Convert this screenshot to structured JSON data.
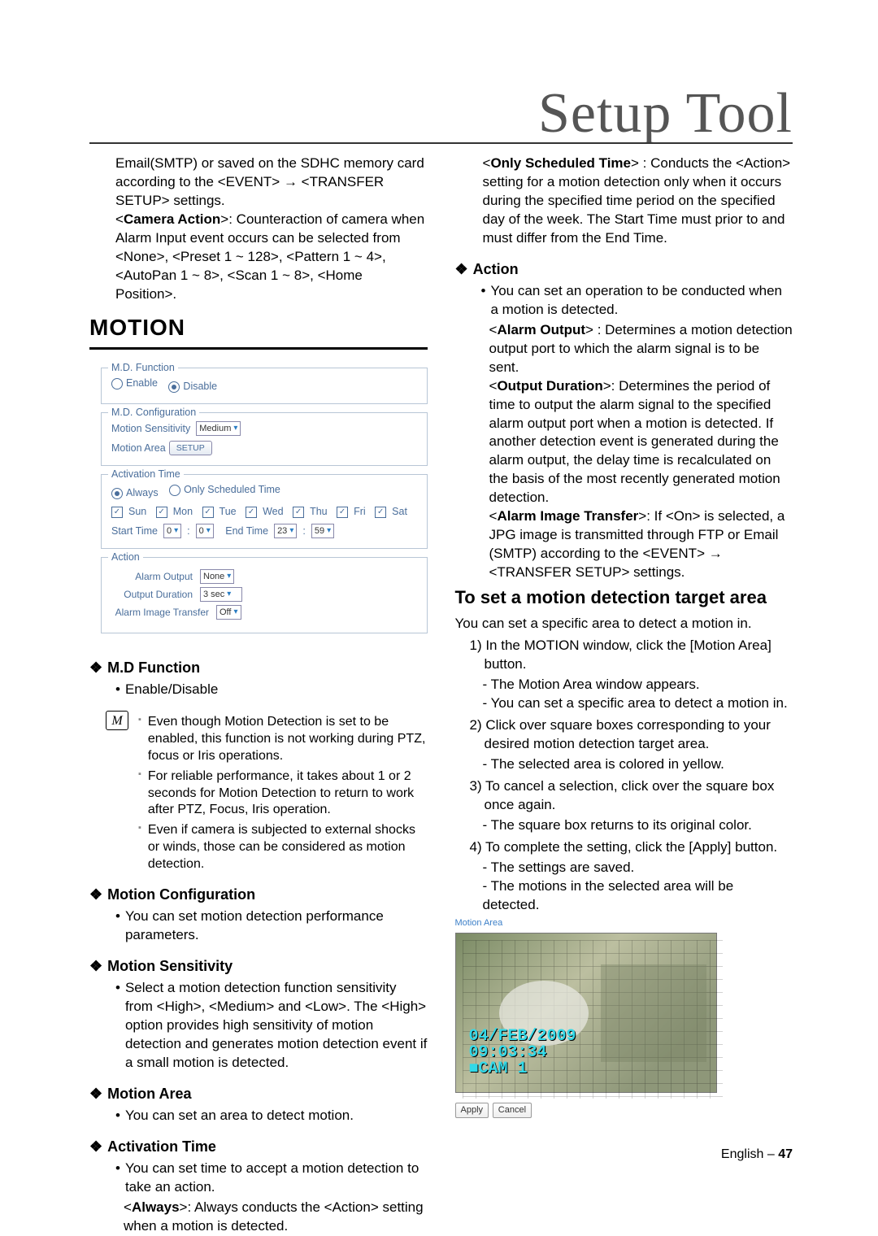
{
  "header": {
    "title": "Setup Tool"
  },
  "footer": {
    "lang": "English –",
    "page": "47"
  },
  "left": {
    "intro_para": "Email(SMTP) or saved on the SDHC memory card according to the <EVENT> → <TRANSFER SETUP> settings.",
    "camera_action_label": "Camera Action",
    "camera_action_text": ">: Counteraction of camera when Alarm Input event occurs can be selected from <None>, <Preset 1 ~ 128>, <Pattern 1 ~ 4>, <AutoPan 1 ~ 8>, <Scan 1 ~ 8>, <Home Position>.",
    "motion_heading": "MOTION",
    "fig": {
      "md_function": {
        "legend": "M.D. Function",
        "enable": "Enable",
        "disable": "Disable"
      },
      "md_config": {
        "legend": "M.D. Configuration",
        "sens_label": "Motion Sensitivity",
        "sens_value": "Medium",
        "area_label": "Motion Area",
        "setup_btn": "SETUP"
      },
      "act_time": {
        "legend": "Activation Time",
        "always": "Always",
        "scheduled": "Only Scheduled Time",
        "days": [
          "Sun",
          "Mon",
          "Tue",
          "Wed",
          "Thu",
          "Fri",
          "Sat"
        ],
        "start_label": "Start Time",
        "end_label": "End Time",
        "start_h": "0",
        "start_m": "0",
        "end_h": "23",
        "end_m": "59"
      },
      "action": {
        "legend": "Action",
        "alarm_out_label": "Alarm Output",
        "alarm_out_value": "None",
        "out_dur_label": "Output Duration",
        "out_dur_value": "3 sec",
        "img_xfer_label": "Alarm Image Transfer",
        "img_xfer_value": "Off"
      }
    },
    "s_md_function": {
      "title": "M.D Function",
      "bullet": "Enable/Disable"
    },
    "notes": {
      "n1": "Even though Motion Detection is set to be enabled, this function is not working during PTZ, focus or Iris operations.",
      "n2": "For reliable performance, it takes about 1 or 2 seconds for Motion Detection to return to work after PTZ, Focus, Iris operation.",
      "n3": "Even if camera is subjected to external shocks or winds, those can be considered as motion detection."
    },
    "s_motion_config": {
      "title": "Motion Configuration",
      "bullet": "You can set motion detection performance parameters."
    },
    "s_motion_sens": {
      "title": "Motion Sensitivity",
      "bullet": "Select a motion detection function sensitivity from <High>, <Medium> and <Low>. The <High> option provides high sensitivity of motion detection and generates motion detection event if a small motion is detected."
    },
    "s_motion_area": {
      "title": "Motion Area",
      "bullet": "You can set an area to detect motion."
    },
    "s_act_time": {
      "title": "Activation Time",
      "bullet": "You can set time to accept a motion detection to take an action.",
      "always_label": "Always",
      "always_text": ">: Always conducts the <Action> setting when a motion is detected."
    }
  },
  "right": {
    "only_scheduled_label": "Only Scheduled Time",
    "only_scheduled_text": "> : Conducts the <Action> setting for a motion detection only when it occurs during the specified time period on the specified day of the week. The Start Time must prior to and must differ from the End Time.",
    "action_title": "Action",
    "action_bullet": "You can set an operation to be conducted when a motion is detected.",
    "alarm_out_label": "Alarm Output",
    "alarm_out_text": "> : Determines a motion detection output port to which the alarm signal is to be sent.",
    "out_dur_label": "Output Duration",
    "out_dur_text": ">: Determines the period of time to output the alarm signal to the specified alarm output port when a motion is detected. If another detection event is generated during the alarm output, the delay time is recalculated on the basis of the most recently generated motion detection.",
    "img_xfer_label": "Alarm Image Transfer",
    "img_xfer_text": ">: If <On> is selected, a JPG image is transmitted through FTP or Email (SMTP) according to the <EVENT> → <TRANSFER SETUP> settings.",
    "set_target_heading": "To set a motion detection target area",
    "set_target_intro": "You can set a specific area to detect a motion in.",
    "steps": {
      "s1": "1) In the MOTION window, click the [Motion Area] button.",
      "s1a": "- The Motion Area window appears.",
      "s1b": "- You can set a specific area to detect a motion in.",
      "s2": "2) Click over square boxes corresponding to your desired motion detection target area.",
      "s2a": "- The selected area is colored in yellow.",
      "s3": "3) To cancel a selection, click over the square box once again.",
      "s3a": "- The square box returns to its original color.",
      "s4": "4) To complete the setting, click the [Apply] button.",
      "s4a": "- The settings are saved.",
      "s4b": "- The motions in the selected area will be detected."
    },
    "fig2": {
      "header": "Motion Area",
      "stamp_line1": "04/FEB/2009",
      "stamp_line2": "09:03:34",
      "stamp_line3": "■CAM 1",
      "apply": "Apply",
      "cancel": "Cancel"
    }
  }
}
